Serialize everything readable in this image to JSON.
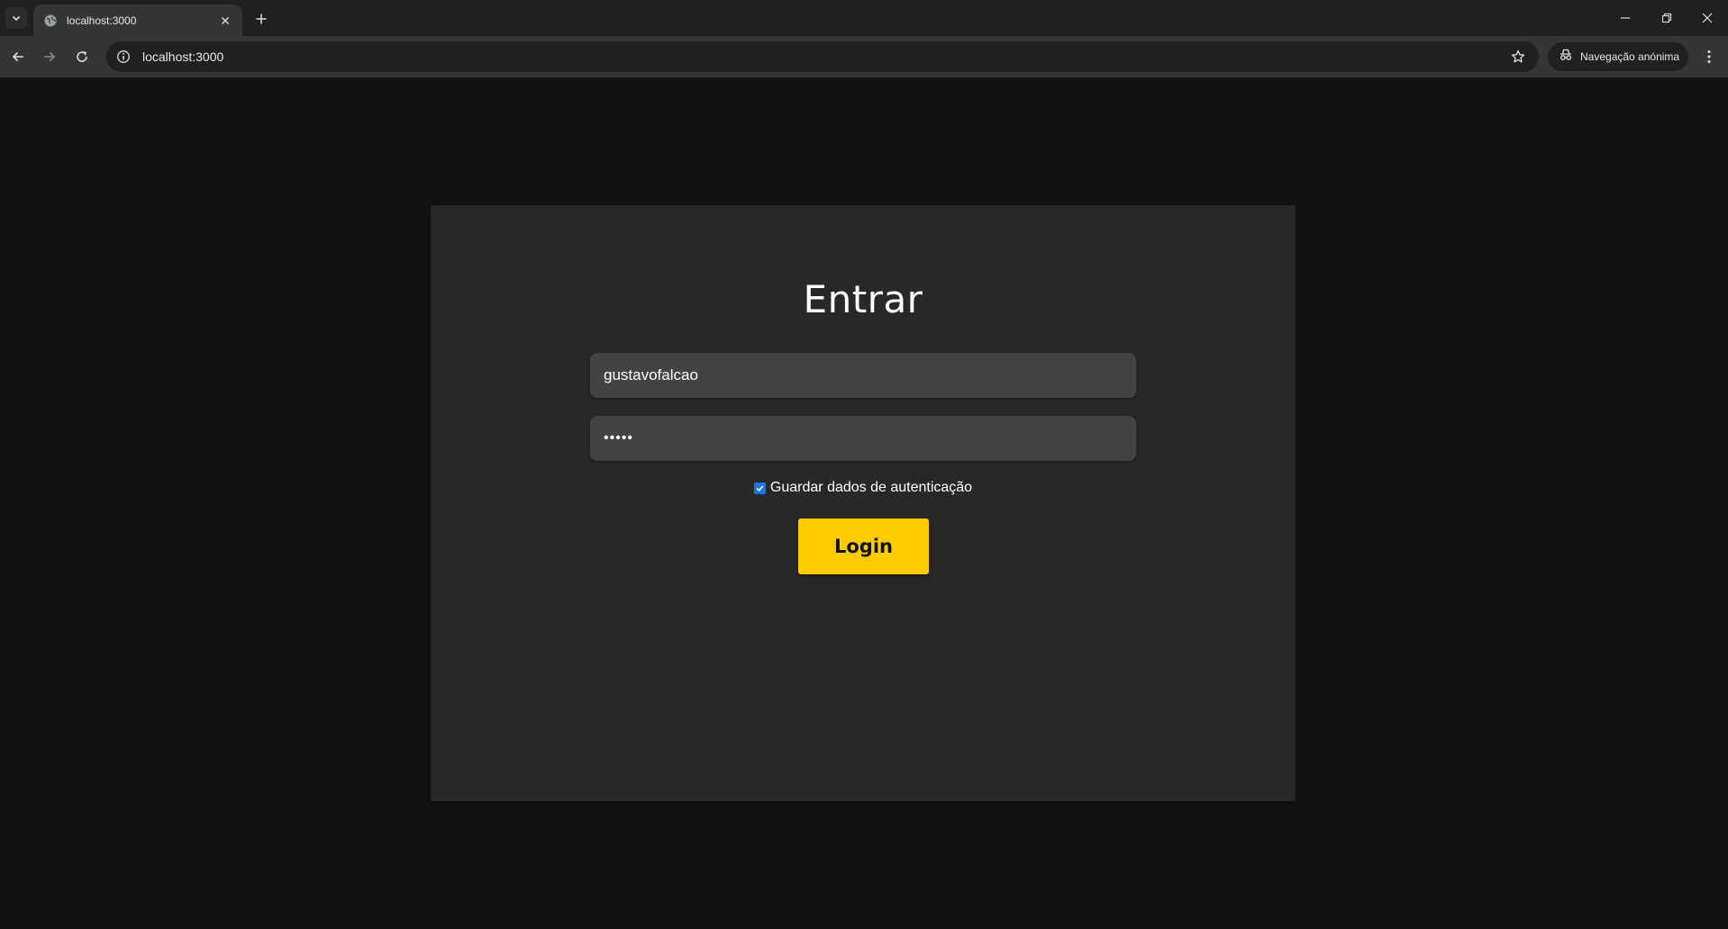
{
  "browser": {
    "tab_title": "localhost:3000",
    "url": "localhost:3000",
    "incognito_label": "Navegação anónima",
    "icons": {
      "tab_search": "chevron-down-icon",
      "favicon": "globe-icon",
      "tab_close": "close-icon",
      "new_tab": "plus-icon",
      "back": "arrow-left-icon",
      "forward": "arrow-right-icon",
      "reload": "reload-icon",
      "site_info": "info-icon",
      "bookmark": "star-icon",
      "incognito": "incognito-icon",
      "menu": "kebab-menu-icon",
      "minimize": "minimize-icon",
      "restore": "restore-icon",
      "close_window": "close-window-icon"
    }
  },
  "login": {
    "title": "Entrar",
    "username_value": "gustavofalcao",
    "password_mask": "•••••",
    "remember_label": "Guardar dados de autenticação",
    "remember_checked": true,
    "login_button": "Login"
  },
  "colors": {
    "page_background": "#121315",
    "card_background": "#282828",
    "input_background": "#434345",
    "accent_button": "#ffcc00",
    "checkbox": "#1a73e8"
  }
}
